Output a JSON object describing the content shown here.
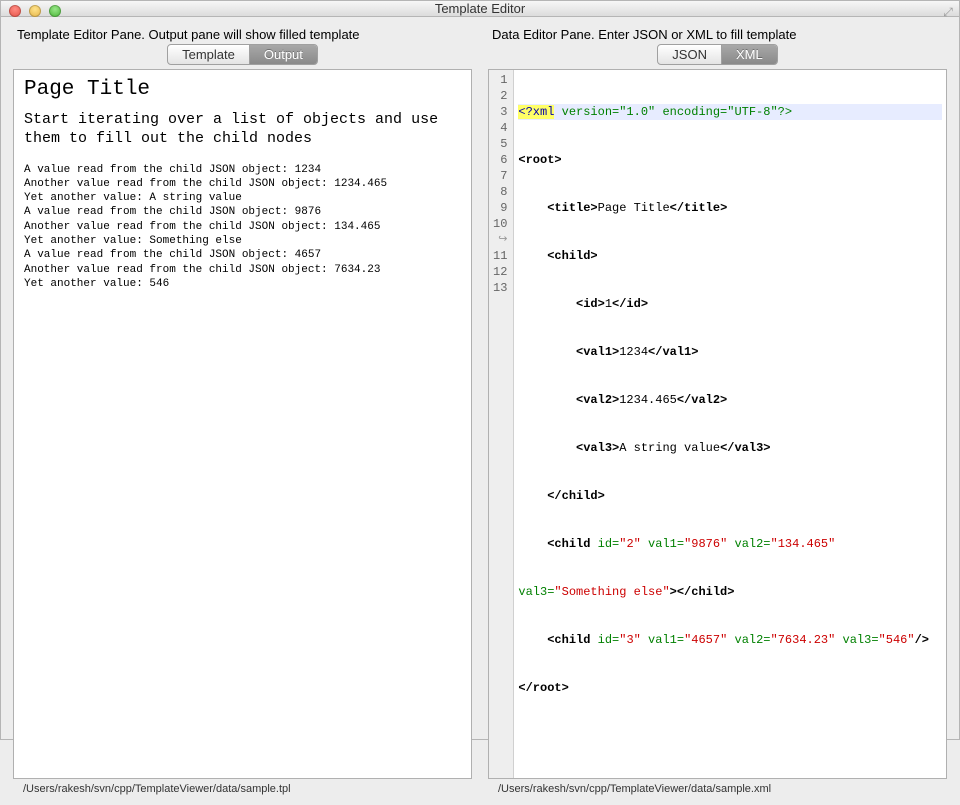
{
  "window": {
    "title": "Template Editor"
  },
  "left": {
    "header": "Template Editor Pane.  Output pane will show filled template",
    "tabs": {
      "template": "Template",
      "output": "Output"
    },
    "output": {
      "title": "Page Title",
      "description": "Start iterating over a list of objects and use them to fill out the child nodes",
      "lines": [
        "A value read from the child JSON object: 1234",
        "Another value read from the child JSON object: 1234.465",
        "Yet another value: A string value",
        "A value read from the child JSON object: 9876",
        "Another value read from the child JSON object: 134.465",
        "Yet another value: Something else",
        "A value read from the child JSON object: 4657",
        "Another value read from the child JSON object: 7634.23",
        "Yet another value: 546"
      ]
    },
    "status": "/Users/rakesh/svn/cpp/TemplateViewer/data/sample.tpl"
  },
  "right": {
    "header": "Data Editor Pane.  Enter JSON or XML to fill template",
    "tabs": {
      "json": "JSON",
      "xml": "XML"
    },
    "code": {
      "gutter": [
        "1",
        "2",
        "3",
        "4",
        "5",
        "6",
        "7",
        "8",
        "9",
        "10",
        "",
        "11",
        "12",
        "13"
      ],
      "decl_q": "<?xml",
      "decl_rest": " version=\"1.0\" encoding=\"UTF-8\"?>",
      "root_open": "<root>",
      "title_open": "<title>",
      "title_text": "Page Title",
      "title_close": "</title>",
      "child_open": "<child>",
      "id_open": "<id>",
      "id_text": "1",
      "id_close": "</id>",
      "val1_open": "<val1>",
      "val1_text": "1234",
      "val1_close": "</val1>",
      "val2_open": "<val2>",
      "val2_text": "1234.465",
      "val2_close": "</val2>",
      "val3_open": "<val3>",
      "val3_text": "A string value",
      "val3_close": "</val3>",
      "child_close": "</child>",
      "c2_tag": "<child",
      "c2_attrs": [
        {
          "name": " id=",
          "val": "\"2\""
        },
        {
          "name": " val1=",
          "val": "\"9876\""
        },
        {
          "name": " val2=",
          "val": "\"134.465\""
        }
      ],
      "c2_wrap_attr": {
        "name": "val3=",
        "val": "\"Something else\""
      },
      "c2_close": "></child>",
      "c3_tag": "<child",
      "c3_attrs": [
        {
          "name": " id=",
          "val": "\"3\""
        },
        {
          "name": " val1=",
          "val": "\"4657\""
        },
        {
          "name": " val2=",
          "val": "\"7634.23\""
        },
        {
          "name": " val3=",
          "val": "\"546\""
        }
      ],
      "c3_close": "/>",
      "root_close": "</root>"
    },
    "status": "/Users/rakesh/svn/cpp/TemplateViewer/data/sample.xml"
  }
}
